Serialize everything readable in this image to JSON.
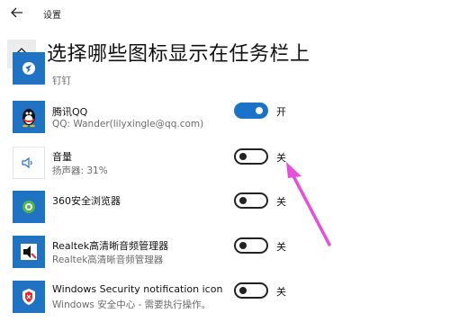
{
  "window": {
    "title": "设置"
  },
  "page": {
    "title": "选择哪些图标显示在任务栏上"
  },
  "items": [
    {
      "name": "",
      "sub": "钉钉",
      "icon": "dingtalk-icon",
      "state": null,
      "state_label": ""
    },
    {
      "name": "腾讯QQ",
      "sub": "QQ: Wander(lilyxingle@qq.com)",
      "icon": "qq-penguin-icon",
      "state": "on",
      "state_label": "开"
    },
    {
      "name": "音量",
      "sub": "扬声器: 31%",
      "icon": "speaker-icon",
      "state": "off",
      "state_label": "关"
    },
    {
      "name": "360安全浏览器",
      "sub": "",
      "icon": "360-browser-icon",
      "state": "off",
      "state_label": "关"
    },
    {
      "name": "Realtek高清晰音频管理器",
      "sub": "Realtek高清晰音频管理器",
      "icon": "realtek-speaker-icon",
      "state": "off",
      "state_label": "关"
    },
    {
      "name": "Windows Security notification icon",
      "sub": "Windows 安全中心 - 需要执行操作。",
      "icon": "security-shield-icon",
      "state": "off",
      "state_label": "关"
    }
  ],
  "colors": {
    "accent": "#1a73c8",
    "annotation_arrow": "#e64fdc"
  }
}
